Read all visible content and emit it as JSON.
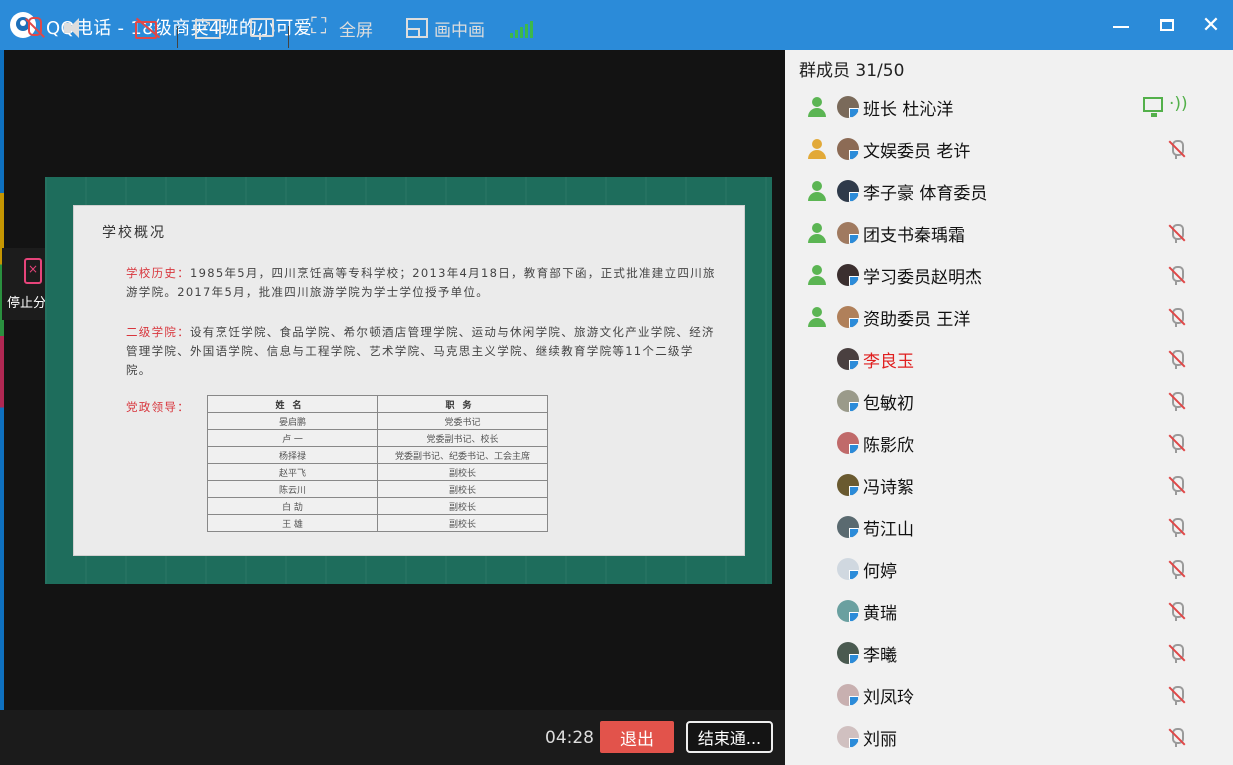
{
  "window": {
    "title": "QQ电话 - 18级商英4班的小可爱",
    "colors": {
      "titlebar": "#2b8bd9",
      "accent_red": "#e2534b",
      "signal_green": "#3cb84a"
    }
  },
  "share": {
    "stop_label": "停止分享"
  },
  "slide": {
    "title": "学校概况",
    "history_label": "学校历史：",
    "history_text": "1985年5月，四川烹饪高等专科学校；2013年4月18日，教育部下函，正式批准建立四川旅游学院。2017年5月，批准四川旅游学院为学士学位授予单位。",
    "colleges_label": "二级学院：",
    "colleges_text": "设有烹饪学院、食品学院、希尔顿酒店管理学院、运动与休闲学院、旅游文化产业学院、经济管理学院、外国语学院、信息与工程学院、艺术学院、马克思主义学院、继续教育学院等11个二级学院。",
    "leaders_label": "党政领导：",
    "table_headers": [
      "姓名",
      "职务"
    ],
    "table_rows": [
      [
        "晏启鹏",
        "党委书记"
      ],
      [
        "卢 一",
        "党委副书记、校长"
      ],
      [
        "杨择禄",
        "党委副书记、纪委书记、工会主席"
      ],
      [
        "赵平飞",
        "副校长"
      ],
      [
        "陈云川",
        "副校长"
      ],
      [
        "白 劼",
        "副校长"
      ],
      [
        "王 雄",
        "副校长"
      ]
    ]
  },
  "toolbar": {
    "fullscreen_label": "全屏",
    "pip_label": "画中画",
    "duration": "04:28",
    "exit_label": "退出",
    "end_label": "结束通..."
  },
  "panel": {
    "header": "群成员 31/50",
    "members": [
      {
        "name": "班长  杜沁洋",
        "role": "green",
        "status": "sharing"
      },
      {
        "name": "文娱委员 老许",
        "role": "gold",
        "status": "muted"
      },
      {
        "name": "李子豪 体育委员",
        "role": "green",
        "status": "none"
      },
      {
        "name": "团支书秦瑀霜",
        "role": "green",
        "status": "muted"
      },
      {
        "name": "学习委员赵明杰",
        "role": "green",
        "status": "muted"
      },
      {
        "name": "资助委员  王洋",
        "role": "green",
        "status": "muted"
      },
      {
        "name": "李良玉",
        "role": "none",
        "status": "muted",
        "highlight": true
      },
      {
        "name": "包敏初",
        "role": "none",
        "status": "muted"
      },
      {
        "name": "陈影欣",
        "role": "none",
        "status": "muted"
      },
      {
        "name": "冯诗絮",
        "role": "none",
        "status": "muted"
      },
      {
        "name": "苟江山",
        "role": "none",
        "status": "muted"
      },
      {
        "name": "何婷",
        "role": "none",
        "status": "muted"
      },
      {
        "name": "黄瑞",
        "role": "none",
        "status": "muted"
      },
      {
        "name": "李曦",
        "role": "none",
        "status": "muted"
      },
      {
        "name": "刘凤玲",
        "role": "none",
        "status": "muted"
      },
      {
        "name": "刘丽",
        "role": "none",
        "status": "muted"
      }
    ]
  }
}
